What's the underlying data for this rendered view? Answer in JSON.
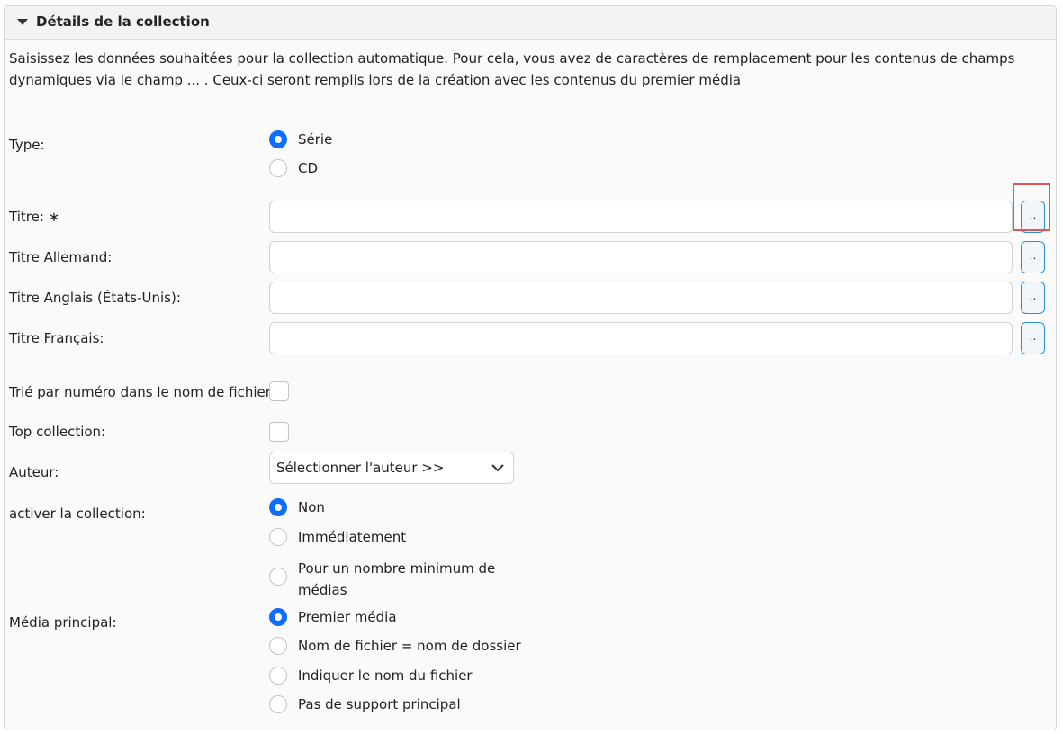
{
  "panel": {
    "title": "Détails de la collection",
    "description": "Saisissez les données souhaitées pour la collection automatique. Pour cela, vous avez de caractères de remplacement pour les contenus de champs dynamiques via le champ ... . Ceux-ci seront remplis lors de la création avec les contenus du premier média"
  },
  "type": {
    "label": "Type:",
    "options": [
      "Série",
      "CD"
    ],
    "selected": "Série"
  },
  "titles": [
    {
      "label": "Titre: ∗",
      "value": "",
      "button": ".."
    },
    {
      "label": "Titre Allemand:",
      "value": "",
      "button": ".."
    },
    {
      "label": "Titre Anglais (États-Unis):",
      "value": "",
      "button": ".."
    },
    {
      "label": "Titre Français:",
      "value": "",
      "button": ".."
    }
  ],
  "sorted": {
    "label": "Trié par numéro dans le nom de fichier:",
    "checked": false
  },
  "top": {
    "label": "Top collection:",
    "checked": false
  },
  "author": {
    "label": "Auteur:",
    "value": "Sélectionner l'auteur >>"
  },
  "activate": {
    "label": "activer la collection:",
    "options": [
      "Non",
      "Immédiatement",
      "Pour un nombre minimum de médias"
    ],
    "option3_line1": "Pour un nombre minimum de",
    "option3_line2": "médias",
    "selected": "Non"
  },
  "media": {
    "label": "Média principal:",
    "options": [
      "Premier média",
      "Nom de fichier = nom de dossier",
      "Indiquer le nom du fichier",
      "Pas de support principal"
    ],
    "selected": "Premier média"
  },
  "colors": {
    "accent": "#0d6efd",
    "highlight": "#e05555"
  }
}
